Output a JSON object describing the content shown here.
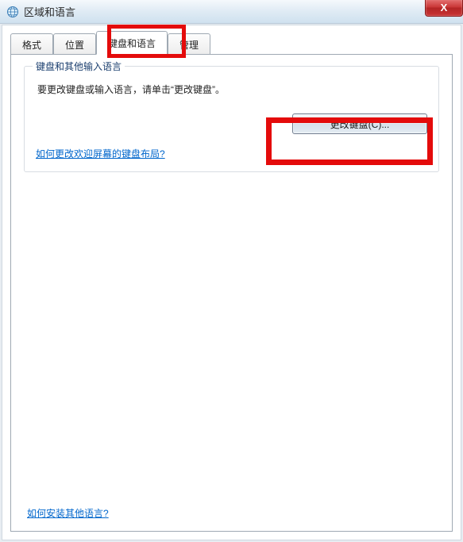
{
  "window": {
    "title": "区域和语言",
    "close_glyph": "X"
  },
  "tabs": {
    "format": "格式",
    "location": "位置",
    "keyboards": "键盘和语言",
    "admin": "管理"
  },
  "group": {
    "title": "键盘和其他输入语言",
    "desc": "要更改键盘或输入语言，请单击“更改键盘”。",
    "change_button": "更改键盘(C)...",
    "welcome_link": "如何更改欢迎屏幕的键盘布局?"
  },
  "bottom_link": "如何安装其他语言?"
}
